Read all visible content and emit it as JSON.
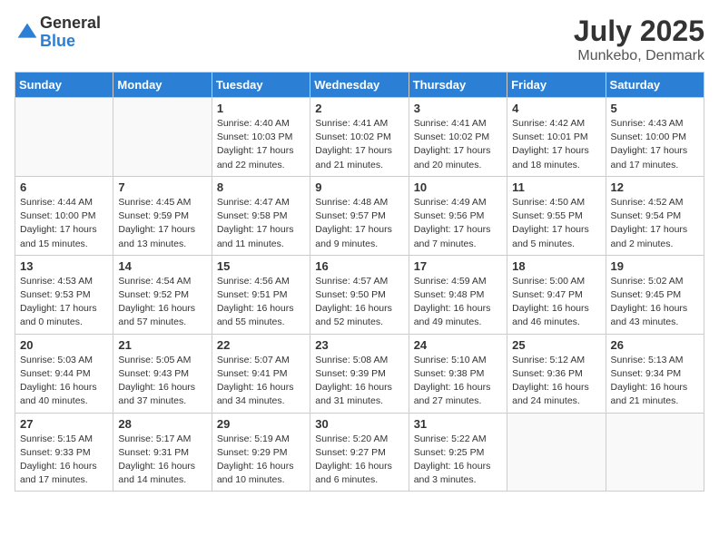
{
  "header": {
    "logo_general": "General",
    "logo_blue": "Blue",
    "month": "July 2025",
    "location": "Munkebo, Denmark"
  },
  "days_of_week": [
    "Sunday",
    "Monday",
    "Tuesday",
    "Wednesday",
    "Thursday",
    "Friday",
    "Saturday"
  ],
  "weeks": [
    [
      {
        "day": "",
        "info": ""
      },
      {
        "day": "",
        "info": ""
      },
      {
        "day": "1",
        "info": "Sunrise: 4:40 AM\nSunset: 10:03 PM\nDaylight: 17 hours and 22 minutes."
      },
      {
        "day": "2",
        "info": "Sunrise: 4:41 AM\nSunset: 10:02 PM\nDaylight: 17 hours and 21 minutes."
      },
      {
        "day": "3",
        "info": "Sunrise: 4:41 AM\nSunset: 10:02 PM\nDaylight: 17 hours and 20 minutes."
      },
      {
        "day": "4",
        "info": "Sunrise: 4:42 AM\nSunset: 10:01 PM\nDaylight: 17 hours and 18 minutes."
      },
      {
        "day": "5",
        "info": "Sunrise: 4:43 AM\nSunset: 10:00 PM\nDaylight: 17 hours and 17 minutes."
      }
    ],
    [
      {
        "day": "6",
        "info": "Sunrise: 4:44 AM\nSunset: 10:00 PM\nDaylight: 17 hours and 15 minutes."
      },
      {
        "day": "7",
        "info": "Sunrise: 4:45 AM\nSunset: 9:59 PM\nDaylight: 17 hours and 13 minutes."
      },
      {
        "day": "8",
        "info": "Sunrise: 4:47 AM\nSunset: 9:58 PM\nDaylight: 17 hours and 11 minutes."
      },
      {
        "day": "9",
        "info": "Sunrise: 4:48 AM\nSunset: 9:57 PM\nDaylight: 17 hours and 9 minutes."
      },
      {
        "day": "10",
        "info": "Sunrise: 4:49 AM\nSunset: 9:56 PM\nDaylight: 17 hours and 7 minutes."
      },
      {
        "day": "11",
        "info": "Sunrise: 4:50 AM\nSunset: 9:55 PM\nDaylight: 17 hours and 5 minutes."
      },
      {
        "day": "12",
        "info": "Sunrise: 4:52 AM\nSunset: 9:54 PM\nDaylight: 17 hours and 2 minutes."
      }
    ],
    [
      {
        "day": "13",
        "info": "Sunrise: 4:53 AM\nSunset: 9:53 PM\nDaylight: 17 hours and 0 minutes."
      },
      {
        "day": "14",
        "info": "Sunrise: 4:54 AM\nSunset: 9:52 PM\nDaylight: 16 hours and 57 minutes."
      },
      {
        "day": "15",
        "info": "Sunrise: 4:56 AM\nSunset: 9:51 PM\nDaylight: 16 hours and 55 minutes."
      },
      {
        "day": "16",
        "info": "Sunrise: 4:57 AM\nSunset: 9:50 PM\nDaylight: 16 hours and 52 minutes."
      },
      {
        "day": "17",
        "info": "Sunrise: 4:59 AM\nSunset: 9:48 PM\nDaylight: 16 hours and 49 minutes."
      },
      {
        "day": "18",
        "info": "Sunrise: 5:00 AM\nSunset: 9:47 PM\nDaylight: 16 hours and 46 minutes."
      },
      {
        "day": "19",
        "info": "Sunrise: 5:02 AM\nSunset: 9:45 PM\nDaylight: 16 hours and 43 minutes."
      }
    ],
    [
      {
        "day": "20",
        "info": "Sunrise: 5:03 AM\nSunset: 9:44 PM\nDaylight: 16 hours and 40 minutes."
      },
      {
        "day": "21",
        "info": "Sunrise: 5:05 AM\nSunset: 9:43 PM\nDaylight: 16 hours and 37 minutes."
      },
      {
        "day": "22",
        "info": "Sunrise: 5:07 AM\nSunset: 9:41 PM\nDaylight: 16 hours and 34 minutes."
      },
      {
        "day": "23",
        "info": "Sunrise: 5:08 AM\nSunset: 9:39 PM\nDaylight: 16 hours and 31 minutes."
      },
      {
        "day": "24",
        "info": "Sunrise: 5:10 AM\nSunset: 9:38 PM\nDaylight: 16 hours and 27 minutes."
      },
      {
        "day": "25",
        "info": "Sunrise: 5:12 AM\nSunset: 9:36 PM\nDaylight: 16 hours and 24 minutes."
      },
      {
        "day": "26",
        "info": "Sunrise: 5:13 AM\nSunset: 9:34 PM\nDaylight: 16 hours and 21 minutes."
      }
    ],
    [
      {
        "day": "27",
        "info": "Sunrise: 5:15 AM\nSunset: 9:33 PM\nDaylight: 16 hours and 17 minutes."
      },
      {
        "day": "28",
        "info": "Sunrise: 5:17 AM\nSunset: 9:31 PM\nDaylight: 16 hours and 14 minutes."
      },
      {
        "day": "29",
        "info": "Sunrise: 5:19 AM\nSunset: 9:29 PM\nDaylight: 16 hours and 10 minutes."
      },
      {
        "day": "30",
        "info": "Sunrise: 5:20 AM\nSunset: 9:27 PM\nDaylight: 16 hours and 6 minutes."
      },
      {
        "day": "31",
        "info": "Sunrise: 5:22 AM\nSunset: 9:25 PM\nDaylight: 16 hours and 3 minutes."
      },
      {
        "day": "",
        "info": ""
      },
      {
        "day": "",
        "info": ""
      }
    ]
  ]
}
